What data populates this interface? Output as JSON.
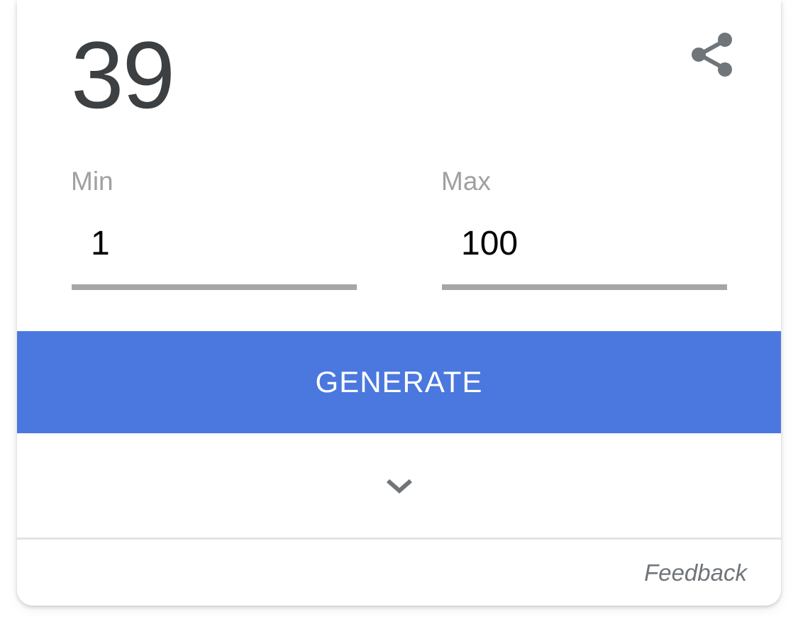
{
  "result": {
    "value": "39"
  },
  "share": {
    "icon": "share-icon",
    "color": "#70757a"
  },
  "min": {
    "label": "Min",
    "value": "1"
  },
  "max": {
    "label": "Max",
    "value": "100"
  },
  "generate": {
    "label": "GENERATE",
    "color": "#4a78de"
  },
  "expand": {
    "icon": "chevron-down-icon"
  },
  "footer": {
    "feedback_label": "Feedback"
  }
}
